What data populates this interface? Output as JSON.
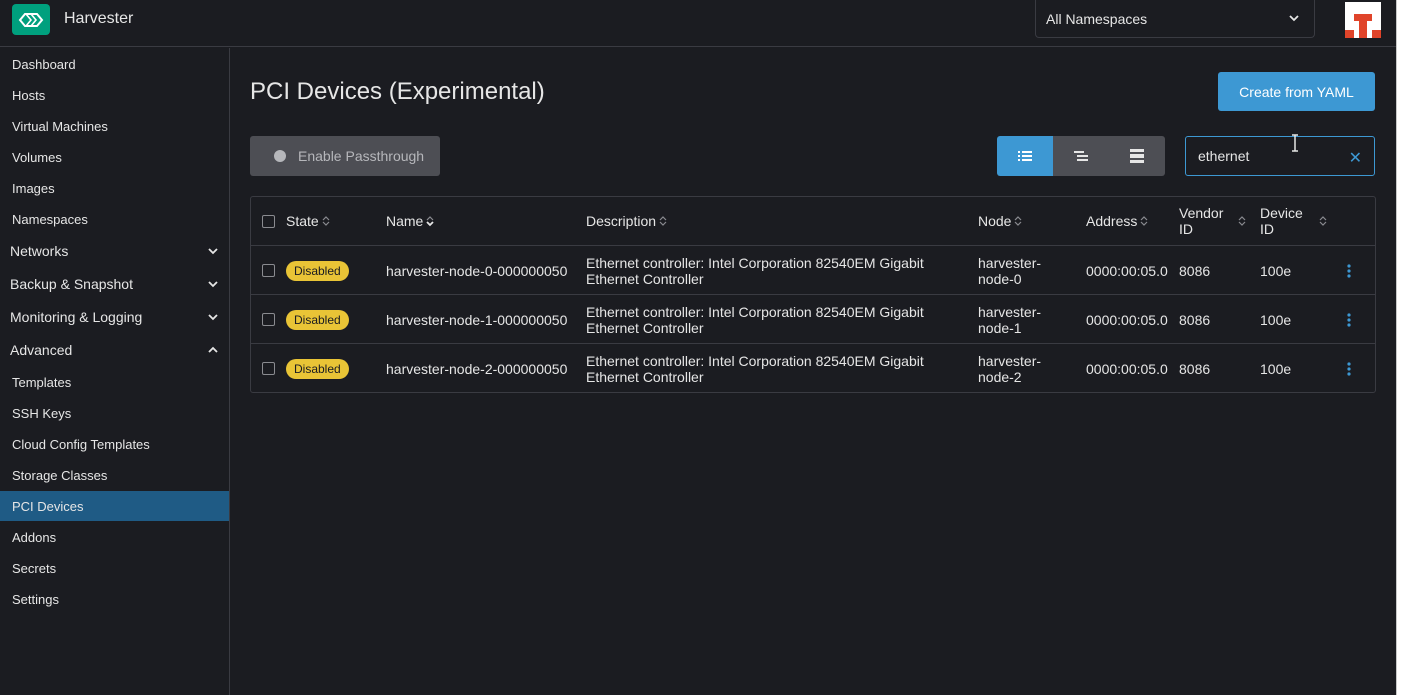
{
  "header": {
    "app_title": "Harvester",
    "namespace_selected": "All Namespaces"
  },
  "sidebar": {
    "items": [
      {
        "label": "Dashboard"
      },
      {
        "label": "Hosts"
      },
      {
        "label": "Virtual Machines"
      },
      {
        "label": "Volumes"
      },
      {
        "label": "Images"
      },
      {
        "label": "Namespaces"
      }
    ],
    "groups": [
      {
        "label": "Networks",
        "expanded": false
      },
      {
        "label": "Backup & Snapshot",
        "expanded": false
      },
      {
        "label": "Monitoring & Logging",
        "expanded": false
      },
      {
        "label": "Advanced",
        "expanded": true
      }
    ],
    "advanced_items": [
      {
        "label": "Templates"
      },
      {
        "label": "SSH Keys"
      },
      {
        "label": "Cloud Config Templates"
      },
      {
        "label": "Storage Classes"
      },
      {
        "label": "PCI Devices",
        "active": true
      },
      {
        "label": "Addons"
      },
      {
        "label": "Secrets"
      },
      {
        "label": "Settings"
      }
    ]
  },
  "main": {
    "title": "PCI Devices (Experimental)",
    "create_label": "Create from YAML",
    "passthrough_label": "Enable Passthrough",
    "search_value": "ethernet",
    "view_modes": [
      "list-icon",
      "tree-icon",
      "group-icon"
    ],
    "active_view": "list-icon"
  },
  "table": {
    "columns": {
      "state": "State",
      "name": "Name",
      "description": "Description",
      "node": "Node",
      "address": "Address",
      "vendor_id": "Vendor ID",
      "device_id": "Device ID"
    },
    "rows": [
      {
        "state": "Disabled",
        "name": "harvester-node-0-000000050",
        "description_line1": "Ethernet controller: Intel Corporation 82540EM Gigabit",
        "description_line2": "Ethernet Controller",
        "node_line1": "harvester-",
        "node_line2": "node-0",
        "address": "0000:00:05.0",
        "vendor_id": "8086",
        "device_id": "100e"
      },
      {
        "state": "Disabled",
        "name": "harvester-node-1-000000050",
        "description_line1": "Ethernet controller: Intel Corporation 82540EM Gigabit",
        "description_line2": "Ethernet Controller",
        "node_line1": "harvester-",
        "node_line2": "node-1",
        "address": "0000:00:05.0",
        "vendor_id": "8086",
        "device_id": "100e"
      },
      {
        "state": "Disabled",
        "name": "harvester-node-2-000000050",
        "description_line1": "Ethernet controller: Intel Corporation 82540EM Gigabit",
        "description_line2": "Ethernet Controller",
        "node_line1": "harvester-",
        "node_line2": "node-2",
        "address": "0000:00:05.0",
        "vendor_id": "8086",
        "device_id": "100e"
      }
    ]
  },
  "colors": {
    "accent": "#3d98d3",
    "brand": "#00a07e",
    "badge_disabled": "#e9c436",
    "active_nav": "#1f5b85"
  }
}
